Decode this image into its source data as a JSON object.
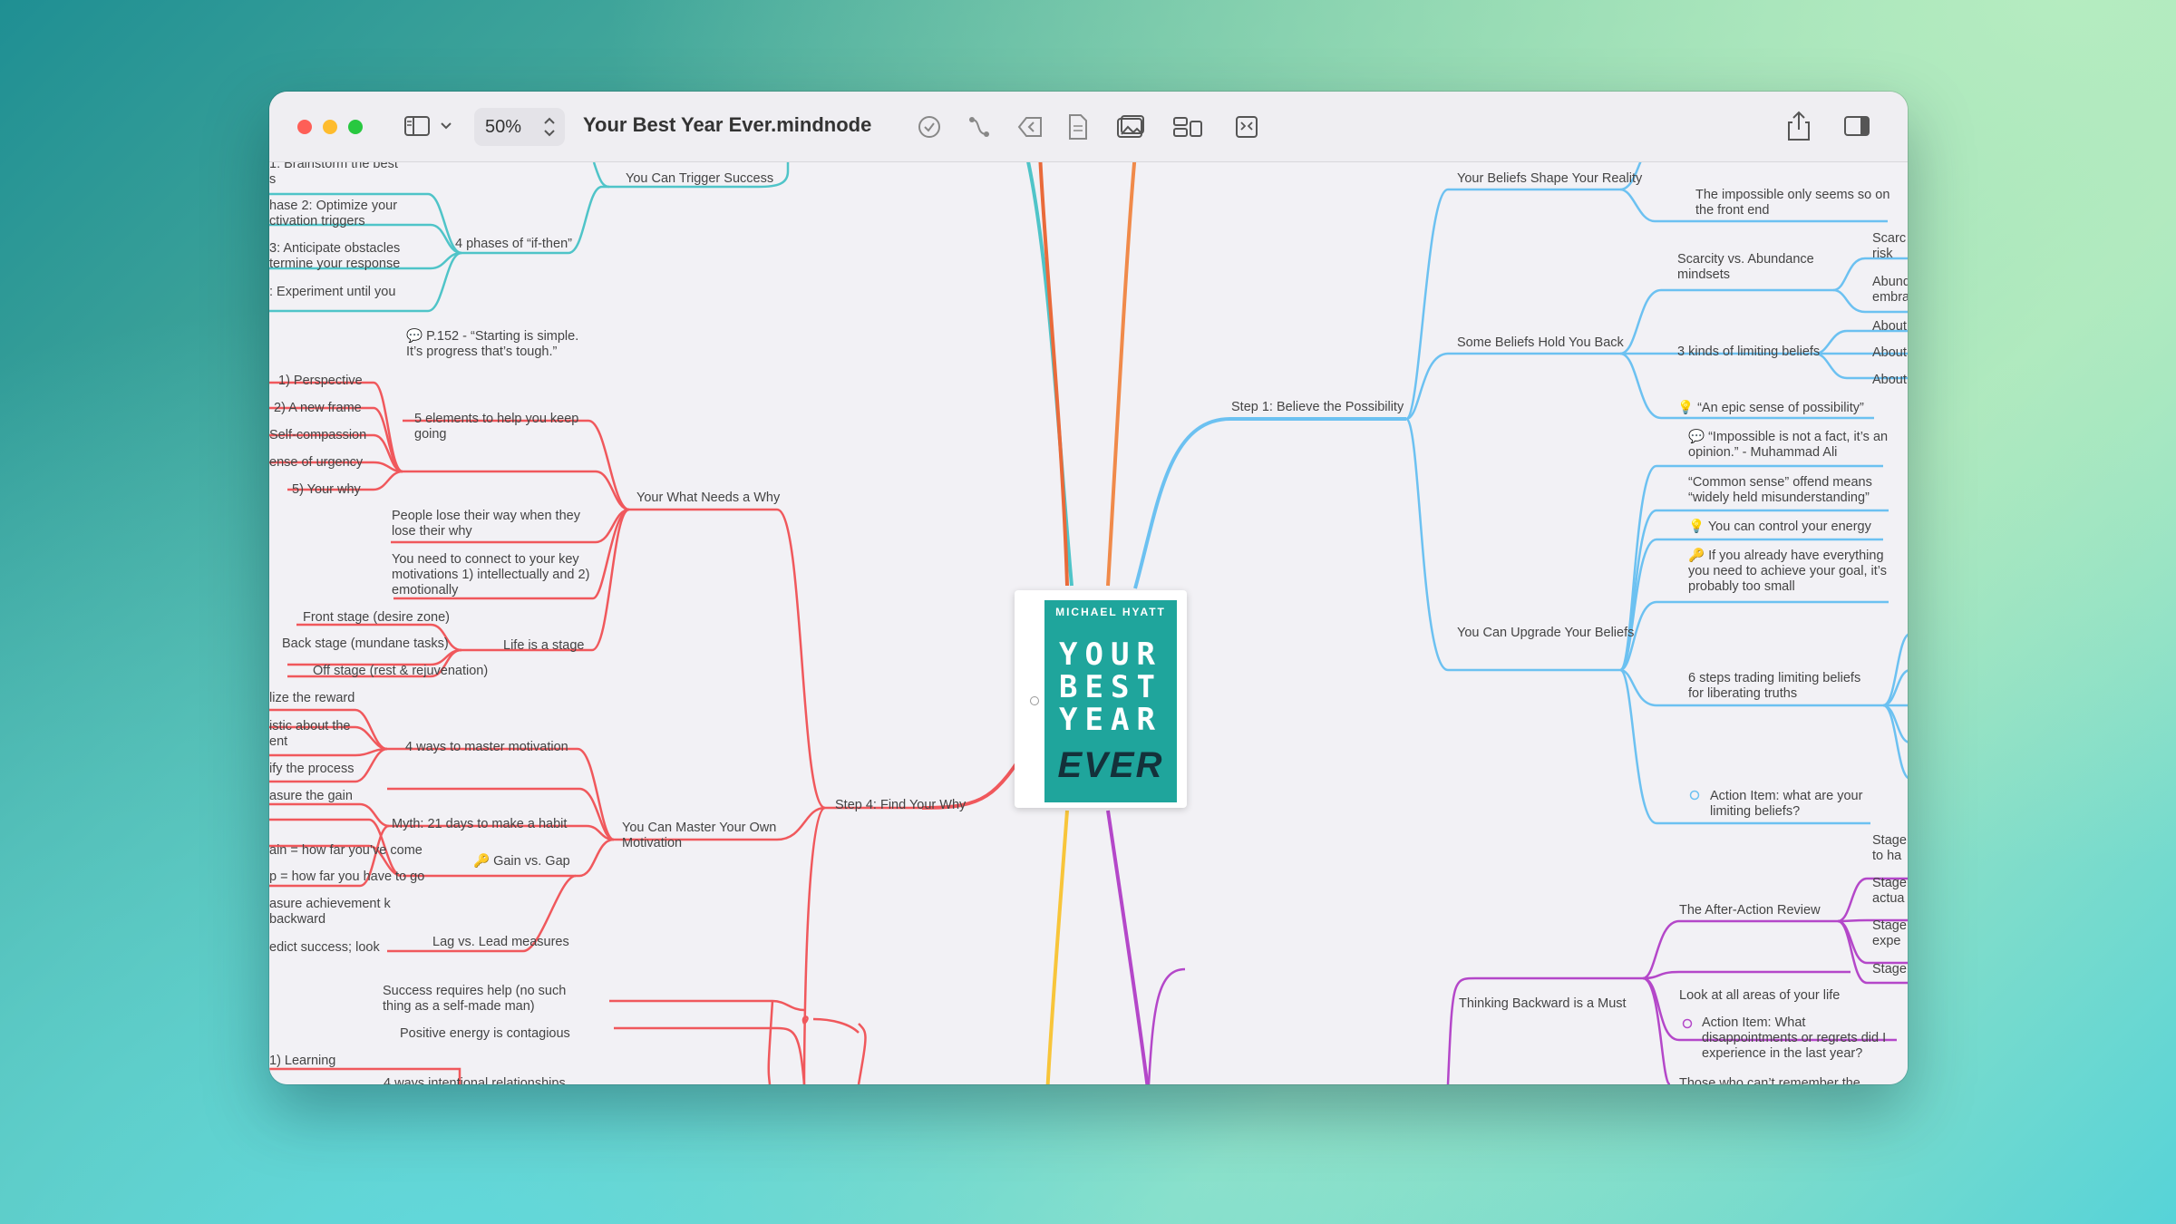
{
  "window": {
    "zoom_value": "50%",
    "document_title": "Your Best Year Ever.mindnode"
  },
  "toolbar_icons": [
    "sidebar-icon",
    "chevron-down-icon",
    "checkmark-circle-icon",
    "connection-icon",
    "back-circle-icon",
    "document-icon",
    "image-icon",
    "layout-icon",
    "focus-icon",
    "share-icon",
    "inspector-icon"
  ],
  "book": {
    "author": "MICHAEL HYATT",
    "title_lines": [
      "YOUR",
      "BEST",
      "YEAR",
      "EVER"
    ]
  },
  "branches": {
    "step4": "Step 4: Find Your Why",
    "step1": "Step 1: Believe the Possibility"
  },
  "left_nodes": {
    "trigger_success": "You Can Trigger Success",
    "brainstorm": "1: Brainstorm the best",
    "brainstorm_tail": "s",
    "phase2": "hase 2: Optimize your ctivation triggers",
    "phase3": "3: Anticipate obstacles termine your response",
    "phase4": ": Experiment until you",
    "four_phases": "4 phases of “if-then”",
    "quote152": "💬 P.152 - “Starting is simple. It’s progress that’s tough.”",
    "perspective": "1) Perspective",
    "new_frame": "2) A new frame",
    "self_comp": "Self-compassion",
    "urgency": "ense of urgency",
    "your_why": "5) Your why",
    "five_elements": "5 elements to help you keep going",
    "what_needs_why": "Your What Needs a Why",
    "lose_way": "People lose their way when they lose their why",
    "connect": "You need to connect to your key motivations 1) intellectually and 2) emotionally",
    "front_stage": "Front stage (desire zone)",
    "back_stage": "Back stage (mundane tasks)",
    "off_stage": "Off stage (rest & rejuvenation)",
    "life_stage": "Life is a stage",
    "reward": "lize the reward",
    "realistic": "istic about the ent",
    "process": "ify the process",
    "measure_gain": "asure the gain",
    "four_ways": "4 ways to master motivation",
    "master_motivation": "You Can Master Your Own Motivation",
    "myth21": "Myth: 21 days to make a habit",
    "gain_far": "ain = how far you’ve come",
    "gap_far": "p = how far you have to go",
    "gain_gap": "🔑 Gain vs. Gap",
    "lag_measure": "asure achievement k backward",
    "lead_measure": "edict success; look",
    "lag_lead": "Lag vs. Lead measures",
    "success_help": "Success requires help (no such thing as a self-made man)",
    "positive_energy": "Positive energy is contagious",
    "learning": "1) Learning",
    "intentional": "4 ways intentional relationships"
  },
  "right_nodes": {
    "beliefs_shape": "Your Beliefs Shape Your Reality",
    "impossible_front": "The impossible only seems so on the front end",
    "scarcity": "Scarcity vs. Abundance mindsets",
    "scarc": "Scarc risk",
    "abund": "Abund embra",
    "hold_back": "Some Beliefs Hold You Back",
    "three_kinds": "3 kinds of limiting beliefs",
    "about1": "About",
    "about2": "About",
    "about3": "About",
    "epic": "💡 “An epic sense of possibility”",
    "impossible_fact": "💬 “Impossible is not a fact, it’s an opinion.” - Muhammad Ali",
    "common_sense": "“Common sense” offend means “widely held misunderstanding”",
    "control_energy": "💡 You can control your energy",
    "already_have": "🔑 If you already have everything you need to achieve your goal, it’s probably too small",
    "upgrade": "You Can Upgrade Your Beliefs",
    "six_steps": "6 steps trading limiting beliefs for liberating truths",
    "action_limiting": "Action Item: what are your limiting beliefs?",
    "stage_a": "Stage to ha",
    "stage_b": "Stage actua",
    "stage_c": "Stage expe",
    "stage_d": "Stage",
    "after_action": "The After-Action Review",
    "thinking_backward": "Thinking Backward is a Must",
    "look_all": "Look at all areas of your life",
    "action_disappoint": "Action Item: What disappointments or regrets did I experience in the last year?",
    "those_who": "Those who can’t remember the"
  },
  "colors": {
    "red": "#f0585c",
    "teal": "#4fc4c8",
    "blue": "#6cc1f1",
    "purple": "#b447c9",
    "orange": "#f08a4a",
    "yellow": "#f8c53a"
  }
}
